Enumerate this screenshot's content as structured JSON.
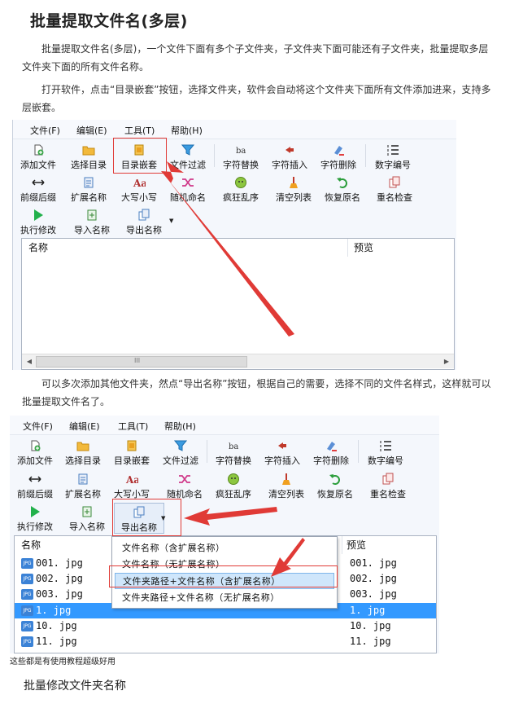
{
  "article": {
    "heading": "批量提取文件名(多层)",
    "para1": "批量提取文件名(多层)，一个文件下面有多个子文件夹，子文件夹下面可能还有子文件夹，批量提取多层文件夹下面的所有文件名称。",
    "para2": "打开软件，点击“目录嵌套”按钮，选择文件夹，软件会自动将这个文件夹下面所有文件添加进来，支持多层嵌套。",
    "para3": "可以多次添加其他文件夹，然点“导出名称”按钮，根据自己的需要，选择不同的文件名样式，这样就可以批量提取文件名了。",
    "caption": "这些都是有使用教程超级好用",
    "next_heading": "批量修改文件夹名称"
  },
  "menu1": [
    "文件(F)",
    "编辑(E)",
    "工具(T)",
    "帮助(H)"
  ],
  "menu2": [
    "文件(F)",
    "编辑(E)",
    "工具(T)",
    "帮助(H)"
  ],
  "toolbar": {
    "row1": [
      "添加文件",
      "选择目录",
      "目录嵌套",
      "文件过滤",
      "字符替换",
      "字符插入",
      "字符删除",
      "数字编号"
    ],
    "row2a": [
      "前缀后缀",
      "扩展名称",
      "大写小写",
      "随机命名",
      "疯狂乱序",
      "清空列表",
      "恢复原名",
      "重名检查"
    ],
    "row2b": [
      "前缀后缀",
      "扩展名称",
      "大写小写",
      "随机命名",
      "疯狂乱序",
      "清空列表",
      "恢复原名",
      "重名检查"
    ],
    "row3": [
      "执行修改",
      "导入名称",
      "导出名称"
    ]
  },
  "list": {
    "col_name": "名称",
    "col_preview": "预览",
    "scroll_grip": "III",
    "jpg_badge": "JPG",
    "files": [
      {
        "name": "001. jpg",
        "preview": "001. jpg"
      },
      {
        "name": "002. jpg",
        "preview": "002. jpg"
      },
      {
        "name": "003. jpg",
        "preview": "003. jpg"
      },
      {
        "name": "1. jpg",
        "preview": "1. jpg"
      },
      {
        "name": "10. jpg",
        "preview": "10. jpg"
      },
      {
        "name": "11. jpg",
        "preview": "11. jpg"
      }
    ],
    "selected_index": 3
  },
  "export_menu": [
    "文件名称（含扩展名称）",
    "文件名称（无扩展名称）",
    "文件夹路径+文件名称（含扩展名称）",
    "文件夹路径+文件名称（无扩展名称）"
  ],
  "colors": {
    "highlight_red": "#e03a36",
    "selection_blue": "#3399ff",
    "menu_highlight": "#cfe6fb"
  }
}
